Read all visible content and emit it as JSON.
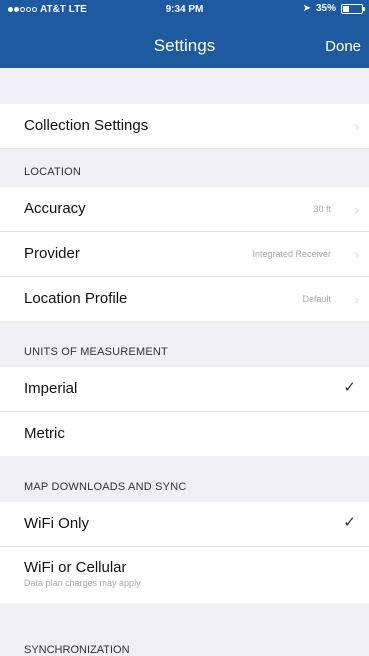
{
  "status_bar": {
    "carrier": "AT&T  LTE",
    "time": "9:34 PM",
    "battery": "35%",
    "battery_level": 0.35
  },
  "nav": {
    "title": "Settings",
    "done_label": "Done"
  },
  "collection": {
    "label": "Collection Settings"
  },
  "location": {
    "header": "LOCATION",
    "rows": [
      {
        "label": "Accuracy",
        "value": "30 ft"
      },
      {
        "label": "Provider",
        "value": "Integrated Receiver"
      },
      {
        "label": "Location Profile",
        "value": "Default"
      }
    ]
  },
  "units": {
    "header": "UNITS OF MEASUREMENT",
    "rows": [
      {
        "label": "Imperial",
        "checked": true
      },
      {
        "label": "Metric",
        "checked": false
      }
    ]
  },
  "map_sync": {
    "header": "MAP DOWNLOADS AND SYNC",
    "rows": [
      {
        "label": "WiFi Only",
        "checked": true
      },
      {
        "label": "WiFi or Cellular",
        "sublabel": "Data plan charges may apply",
        "checked": false
      }
    ]
  },
  "sync": {
    "header": "SYNCHRONIZATION"
  },
  "icons": {
    "check": "checkmark-icon",
    "chevron": "chevron-right-icon"
  }
}
